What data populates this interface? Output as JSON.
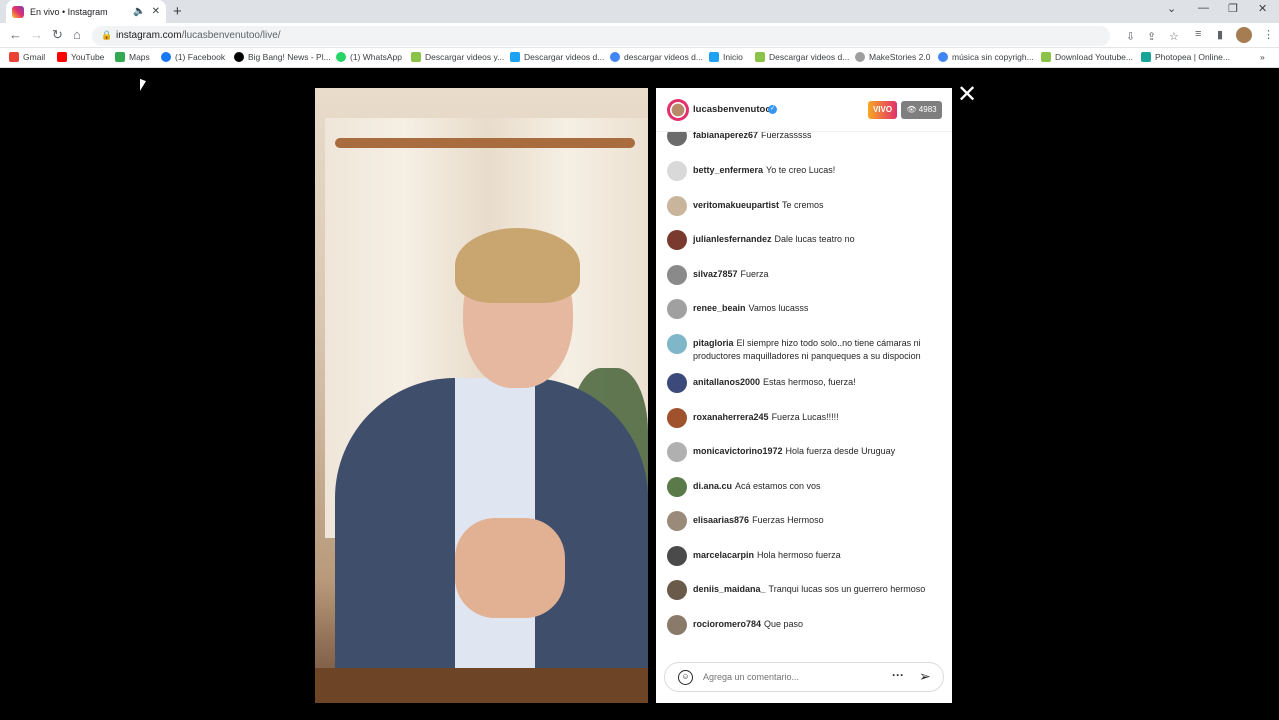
{
  "browser": {
    "tab_title": "En vivo • Instagram",
    "url_main": "instagram.com",
    "url_path": "/lucasbenvenutoo/live/",
    "bookmarks": [
      {
        "label": "Gmail",
        "color": "#ea4335"
      },
      {
        "label": "YouTube",
        "color": "#ff0000"
      },
      {
        "label": "Maps",
        "color": "#34a853"
      },
      {
        "label": "(1) Facebook",
        "color": "#1877f2"
      },
      {
        "label": "Big Bang! News - Pl...",
        "color": "#000000"
      },
      {
        "label": "(1) WhatsApp",
        "color": "#25d366"
      },
      {
        "label": "Descargar videos y...",
        "color": "#8bc34a"
      },
      {
        "label": "Descargar videos d...",
        "color": "#1da1f2"
      },
      {
        "label": "descargar videos d...",
        "color": "#4285f4"
      },
      {
        "label": "Inicio",
        "color": "#1da1f2"
      },
      {
        "label": "Descargar videos d...",
        "color": "#8bc34a"
      },
      {
        "label": "MakeStories 2.0",
        "color": "#9e9e9e"
      },
      {
        "label": "música sin copyrigh...",
        "color": "#4285f4"
      },
      {
        "label": "Download Youtube...",
        "color": "#8bc34a"
      },
      {
        "label": "Photopea | Online...",
        "color": "#18a497"
      }
    ]
  },
  "live": {
    "host": "lucasbenvenutoo",
    "live_badge": "VIVO",
    "viewer_count": "4983",
    "composer_placeholder": "Agrega un comentario...",
    "comments": [
      {
        "user": "fabianaperez67",
        "text": "Fuerzasssss",
        "color": "#6b6b6b"
      },
      {
        "user": "betty_enfermera",
        "text": "Yo te creo Lucas!",
        "color": "#d9d9d9"
      },
      {
        "user": "veritomakueupartist",
        "text": "Te cremos",
        "color": "#c8b59b"
      },
      {
        "user": "julianlesfernandez",
        "text": "Dale lucas teatro no",
        "color": "#7a3b2e"
      },
      {
        "user": "silvaz7857",
        "text": "Fuerza",
        "color": "#8a8a8a"
      },
      {
        "user": "renee_beain",
        "text": "Vamos lucasss",
        "color": "#a0a0a0"
      },
      {
        "user": "pitagloria",
        "text": "El siempre hizo todo solo..no tiene cámaras ni productores maquilladores ni panqueques a su dispocion",
        "color": "#7fb7c9"
      },
      {
        "user": "anitallanos2000",
        "text": "Estas hermoso, fuerza!",
        "color": "#3b4a7a"
      },
      {
        "user": "roxanaherrera245",
        "text": "Fuerza Lucas!!!!!",
        "color": "#a0522d"
      },
      {
        "user": "monicavictorino1972",
        "text": "Hola fuerza desde Uruguay",
        "color": "#b0b0b0"
      },
      {
        "user": "di.ana.cu",
        "text": "Acá estamos con vos",
        "color": "#5a7a4a"
      },
      {
        "user": "elisaarias876",
        "text": "Fuerzas Hermoso",
        "color": "#9a8a7a"
      },
      {
        "user": "marcelacarpin",
        "text": "Hola hermoso fuerza",
        "color": "#4a4a4a"
      },
      {
        "user": "deniis_maidana_",
        "text": "Tranqui lucas sos un guerrero hermoso",
        "color": "#6a5a4a"
      },
      {
        "user": "rocioromero784",
        "text": "Que paso",
        "color": "#8a7a6a"
      }
    ]
  }
}
